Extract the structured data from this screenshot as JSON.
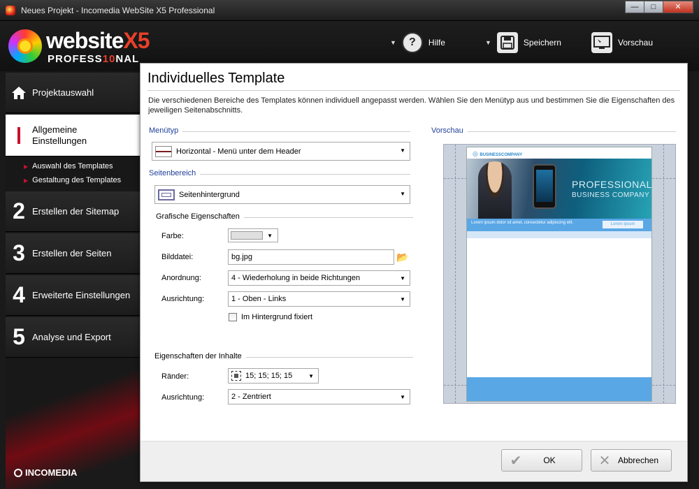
{
  "window": {
    "title": "Neues Projekt - Incomedia WebSite X5 Professional",
    "minimize": "—",
    "maximize": "□",
    "close": "✕"
  },
  "logo": {
    "word": "website",
    "version": "X5",
    "edition_pre": "PROFESS",
    "edition_hl": "10",
    "edition_post": "NAL"
  },
  "toolbar": {
    "help_label": "Hilfe",
    "save_label": "Speichern",
    "preview_label": "Vorschau"
  },
  "sidebar": {
    "items": [
      {
        "num": "",
        "label": "Projektauswahl"
      },
      {
        "num": "1",
        "label_line1": "Allgemeine",
        "label_line2": "Einstellungen"
      },
      {
        "num": "2",
        "label": "Erstellen der Sitemap"
      },
      {
        "num": "3",
        "label": "Erstellen der Seiten"
      },
      {
        "num": "4",
        "label": "Erweiterte Einstellungen"
      },
      {
        "num": "5",
        "label": "Analyse und Export"
      }
    ],
    "subitems": [
      "Auswahl des Templates",
      "Gestaltung des Templates"
    ],
    "brand": "INCOMEDIA"
  },
  "main": {
    "title": "Individuelles Template",
    "description": "Die verschiedenen Bereiche des Templates können individuell angepasst werden. Wählen Sie den Menütyp aus und bestimmen Sie die Eigenschaften des jeweiligen Seitenabschnitts.",
    "menutyp": {
      "section": "Menütyp",
      "value": "Horizontal - Menü unter dem Header"
    },
    "seitenbereich": {
      "section": "Seitenbereich",
      "value": "Seitenhintergrund"
    },
    "grafisch": {
      "section": "Grafische Eigenschaften",
      "farbe_label": "Farbe:",
      "farbe_color": "#e0e0e0",
      "bilddatei_label": "Bilddatei:",
      "bilddatei_value": "bg.jpg",
      "anordnung_label": "Anordnung:",
      "anordnung_value": "4 - Wiederholung in beide Richtungen",
      "ausrichtung_label": "Ausrichtung:",
      "ausrichtung_value": "1 - Oben - Links",
      "fixed_label": "Im Hintergrund fixiert",
      "fixed_checked": false
    },
    "inhalte": {
      "section": "Eigenschaften der Inhalte",
      "raender_label": "Ränder:",
      "raender_value": "15; 15; 15; 15",
      "ausrichtung_label": "Ausrichtung:",
      "ausrichtung_value": "2 - Zentriert"
    },
    "vorschau": {
      "section": "Vorschau",
      "logo_text": "BUSINESSCOMPANY",
      "headline": "PROFESSIONAL",
      "subheadline": "BUSINESS COMPANY",
      "menu_text": "Lorem ipsum dolor sit amet, consectetur adipiscing elit.",
      "menu_button": "Lorem ipsum"
    }
  },
  "buttons": {
    "ok_label": "OK",
    "cancel_label": "Abbrechen"
  },
  "colors": {
    "accent_red": "#c8102e",
    "section_blue": "#1f3f9a",
    "preview_blue": "#5aa7e6"
  }
}
